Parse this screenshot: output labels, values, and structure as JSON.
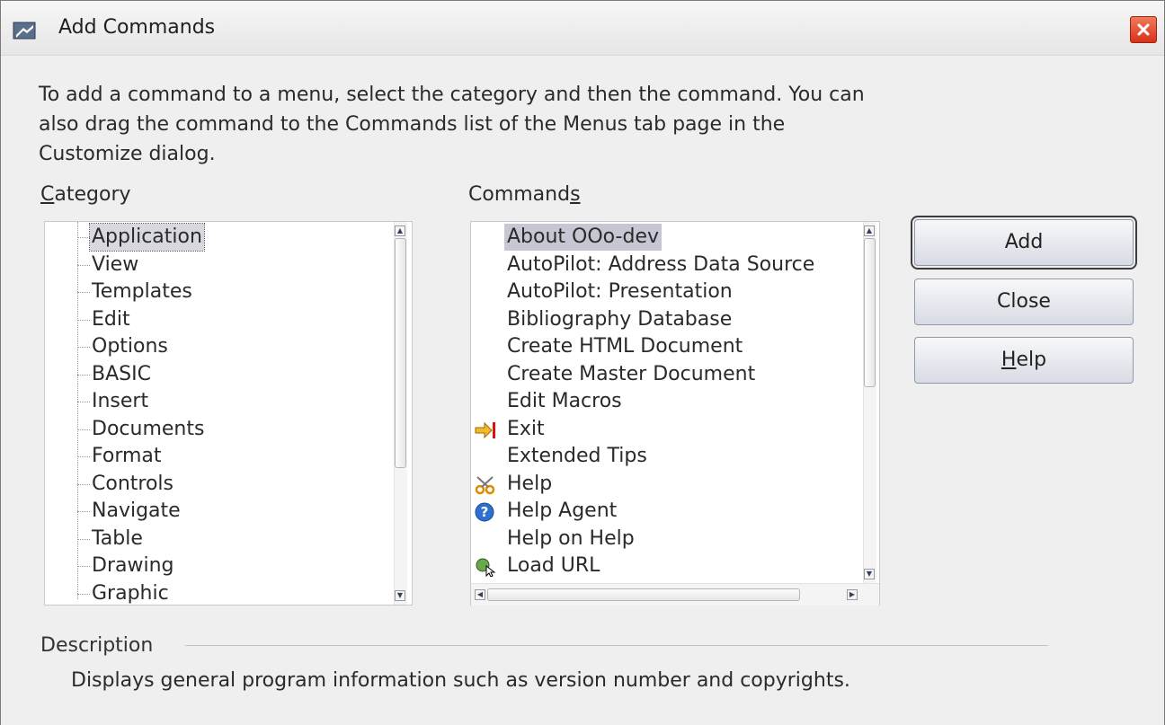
{
  "window": {
    "title": "Add Commands"
  },
  "intro": "To add a command to a menu, select the category and then the command. You can also drag the command to the Commands list of the Menus tab page in the Customize dialog.",
  "category": {
    "label_underlined": "C",
    "label_rest": "ategory",
    "items": [
      "Application",
      "View",
      "Templates",
      "Edit",
      "Options",
      "BASIC",
      "Insert",
      "Documents",
      "Format",
      "Controls",
      "Navigate",
      "Table",
      "Drawing",
      "Graphic"
    ],
    "selected": "Application"
  },
  "commands": {
    "label_prefix": "Command",
    "label_underlined": "s",
    "items": [
      {
        "label": "About OOo-dev",
        "icon": ""
      },
      {
        "label": "AutoPilot: Address Data Source",
        "icon": ""
      },
      {
        "label": "AutoPilot: Presentation",
        "icon": ""
      },
      {
        "label": "Bibliography Database",
        "icon": ""
      },
      {
        "label": "Create HTML Document",
        "icon": ""
      },
      {
        "label": "Create Master Document",
        "icon": ""
      },
      {
        "label": "Edit Macros",
        "icon": ""
      },
      {
        "label": "Exit",
        "icon": "exit-arrow-icon"
      },
      {
        "label": "Extended Tips",
        "icon": ""
      },
      {
        "label": "Help",
        "icon": "scissors-icon"
      },
      {
        "label": "Help Agent",
        "icon": "help-question-icon"
      },
      {
        "label": "Help on Help",
        "icon": ""
      },
      {
        "label": "Load URL",
        "icon": "load-url-globe-icon"
      }
    ],
    "selected": "About OOo-dev"
  },
  "buttons": {
    "add": "Add",
    "close": "Close",
    "help_underlined": "H",
    "help_rest": "elp"
  },
  "description": {
    "label": "Description",
    "text": "Displays general program information such as version number and copyrights."
  }
}
